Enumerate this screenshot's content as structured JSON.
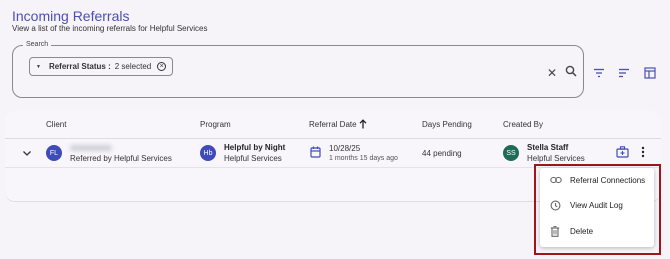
{
  "header": {
    "title": "Incoming Referrals",
    "subtitle": "View a list of the incoming referrals for Helpful Services"
  },
  "search": {
    "label": "Search",
    "chip_label": "Referral Status :",
    "chip_value": "2 selected"
  },
  "table": {
    "columns": [
      "Client",
      "Program",
      "Referral Date",
      "Days Pending",
      "Created By"
    ],
    "rows": [
      {
        "client_initials": "FL",
        "client_sub": "Referred by Helpful Services",
        "program_initials": "Hb",
        "program_name": "Helpful by Night",
        "program_org": "Helpful Services",
        "referral_date": "10/28/25",
        "referral_ago": "1 months 15 days ago",
        "days_pending": "44 pending",
        "creator_initials": "SS",
        "creator_name": "Stella Staff",
        "creator_org": "Helpful Services"
      }
    ]
  },
  "menu": {
    "items": [
      {
        "label": "Referral Connections",
        "icon": "link-icon"
      },
      {
        "label": "View Audit Log",
        "icon": "history-icon"
      },
      {
        "label": "Delete",
        "icon": "trash-icon"
      }
    ]
  },
  "colors": {
    "accent": "#4a4fb4",
    "client_avatar": "#3f4bb8",
    "creator_avatar": "#1f6b58",
    "highlight": "#a0141a"
  }
}
